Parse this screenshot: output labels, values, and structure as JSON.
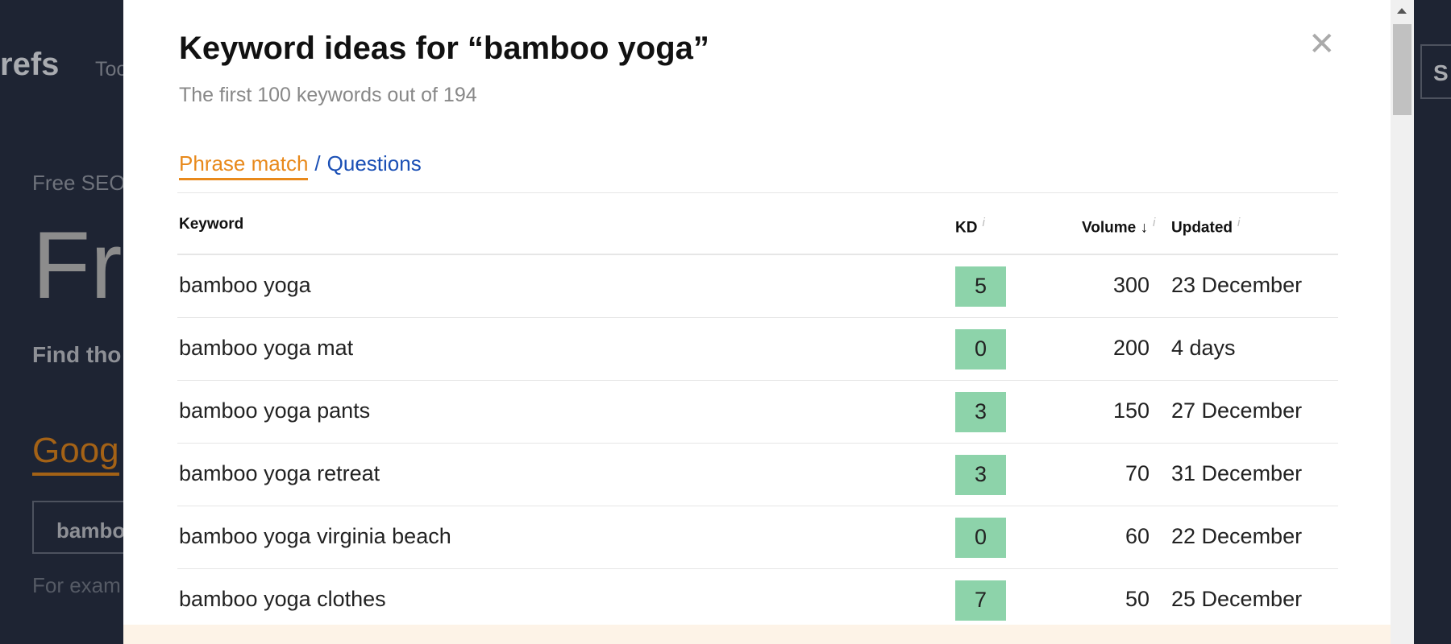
{
  "background": {
    "logo": "refs",
    "nav": "Too",
    "eyebrow": "Free SEO",
    "heading": "Fr",
    "tagline": "Find tho",
    "engine_tab": "Goog",
    "search_value": "bambo",
    "example": "For exam",
    "right_button": "S"
  },
  "modal": {
    "title": "Keyword ideas for “bamboo yoga”",
    "subtitle": "The first 100 keywords out of 194",
    "tabs": [
      {
        "label": "Phrase match",
        "active": true
      },
      {
        "label": "Questions",
        "active": false
      }
    ],
    "tab_separator": "/",
    "close_icon": "close-icon",
    "columns": {
      "keyword": "Keyword",
      "kd": "KD",
      "volume": "Volume ↓",
      "updated": "Updated",
      "info": "i"
    },
    "kd_color": "#8dd3aa",
    "rows": [
      {
        "keyword": "bamboo yoga",
        "kd": "5",
        "volume": "300",
        "updated": "23 December"
      },
      {
        "keyword": "bamboo yoga mat",
        "kd": "0",
        "volume": "200",
        "updated": "4 days"
      },
      {
        "keyword": "bamboo yoga pants",
        "kd": "3",
        "volume": "150",
        "updated": "27 December"
      },
      {
        "keyword": "bamboo yoga retreat",
        "kd": "3",
        "volume": "70",
        "updated": "31 December"
      },
      {
        "keyword": "bamboo yoga virginia beach",
        "kd": "0",
        "volume": "60",
        "updated": "22 December"
      },
      {
        "keyword": "bamboo yoga clothes",
        "kd": "7",
        "volume": "50",
        "updated": "25 December"
      }
    ]
  }
}
